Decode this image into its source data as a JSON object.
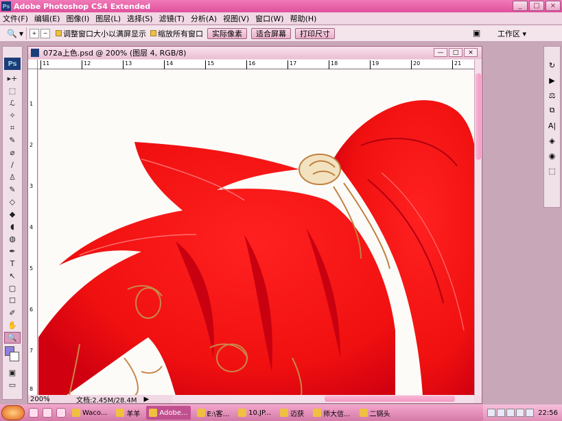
{
  "app": {
    "title": "Adobe Photoshop CS4 Extended",
    "ps_logo": "Ps"
  },
  "window_buttons": [
    "_",
    "□",
    "×"
  ],
  "menu": [
    "文件(F)",
    "编辑(E)",
    "图像(I)",
    "图层(L)",
    "选择(S)",
    "滤镜(T)",
    "分析(A)",
    "视图(V)",
    "窗口(W)",
    "帮助(H)"
  ],
  "options": {
    "zoom_glyph": "🔍",
    "zoom_arrow": "▾",
    "zoom_in": "+",
    "zoom_out": "−",
    "check1": "调整窗口大小以满屏显示",
    "check2": "缩放所有窗口",
    "btn_actual": "实际像素",
    "btn_fit": "适合屏幕",
    "btn_print": "打印尺寸",
    "workspace": "工作区 ▾"
  },
  "toolbox": {
    "logo": "Ps",
    "tools": [
      "▸+",
      "⬚",
      "ℒ",
      "✧",
      "⌗",
      "✎",
      "⌀",
      "/",
      "♙",
      "✎",
      "◇",
      "◆",
      "◖",
      "◍",
      "✒",
      "T",
      "↖",
      "▢",
      "☐",
      "✐",
      "✋",
      "🔍"
    ],
    "bottom": [
      "▣",
      "▭"
    ]
  },
  "right_panel": [
    "↻",
    "▶",
    "⚖",
    "⧉",
    "A|",
    "◈",
    "◉",
    "⬚"
  ],
  "document": {
    "title": "072a上色.psd @ 200% (图层 4, RGB/8)",
    "h_ruler_ticks": [
      "11",
      "12",
      "13",
      "14",
      "15",
      "16",
      "17",
      "18",
      "19",
      "20",
      "21"
    ],
    "v_ruler_ticks": [
      "1",
      "2",
      "3",
      "4",
      "5",
      "6",
      "7",
      "8"
    ],
    "doc_buttons": [
      "—",
      "□",
      "×"
    ],
    "status_zoom": "200%",
    "status_info": "文档:2.45M/28.4M",
    "status_arrow": "▶"
  },
  "taskbar": {
    "items": [
      {
        "label": "Waco...",
        "active": false
      },
      {
        "label": "羊羊",
        "active": false
      },
      {
        "label": "Adobe...",
        "active": true
      },
      {
        "label": "E:\\客...",
        "active": false
      },
      {
        "label": "10.JP...",
        "active": false
      },
      {
        "label": "迈获",
        "active": false
      },
      {
        "label": "师大信...",
        "active": false
      },
      {
        "label": "二锅头",
        "active": false
      }
    ],
    "clock": "22:56"
  }
}
